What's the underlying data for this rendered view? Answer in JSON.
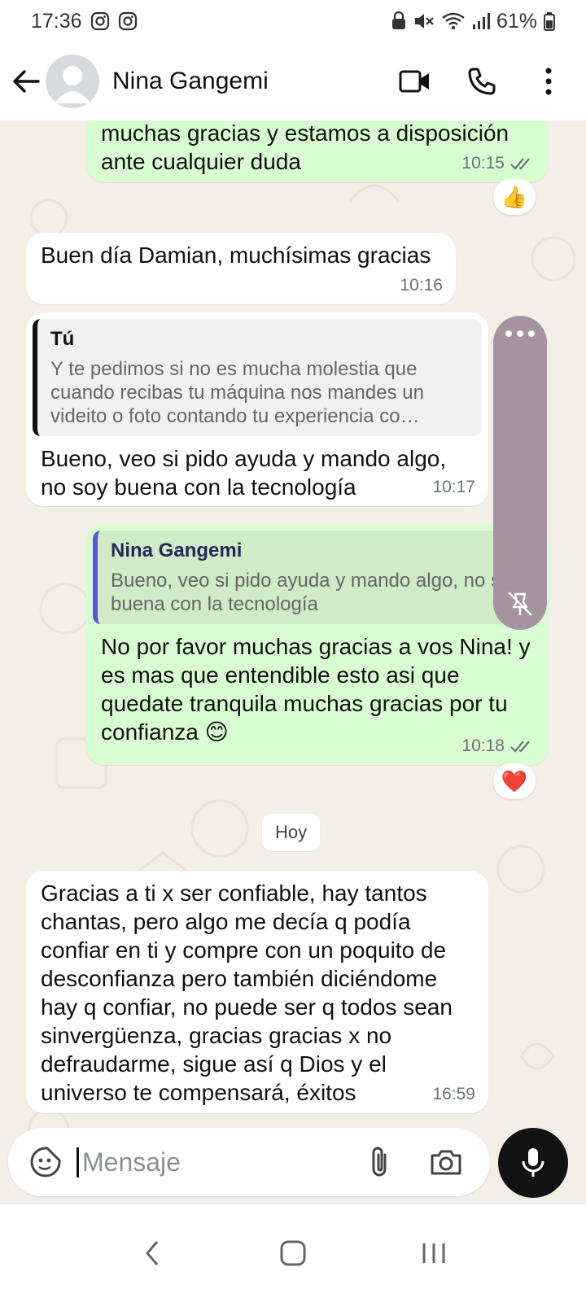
{
  "status_bar": {
    "time": "17:36",
    "battery": "61%"
  },
  "header": {
    "contact_name": "Nina Gangemi"
  },
  "messages": [
    {
      "direction": "out",
      "text": "muchas gracias y estamos a disposición ante cualquier duda",
      "time": "10:15",
      "reaction": "👍"
    },
    {
      "direction": "in",
      "text": "Buen día Damian, muchísimas gracias",
      "time": "10:16"
    },
    {
      "direction": "in",
      "quote": {
        "author": "Tú",
        "text": "Y te pedimos si no es mucha molestia que cuando recibas tu máquina nos mandes un videito o foto contando tu experiencia co…"
      },
      "text": "Bueno, veo si pido ayuda y mando algo, no soy buena con la tecnología",
      "time": "10:17"
    },
    {
      "direction": "out",
      "quote": {
        "author": "Nina Gangemi",
        "text": "Bueno, veo si pido ayuda y mando algo, no soy buena con la tecnología"
      },
      "text": "No por favor muchas gracias a vos Nina! y es mas que entendible esto asi que quedate tranquila muchas gracias por tu confianza 😊",
      "time": "10:18",
      "reaction": "❤️"
    },
    {
      "direction": "in",
      "text": "Gracias a ti x ser confiable, hay tantos chantas, pero algo me decía q podía confiar en ti y compre con un poquito de desconfianza pero también diciéndome hay q confiar, no puede ser q todos sean sinvergüenza, gracias gracias x no defraudarme, sigue así q Dios y el universo te compensará, éxitos",
      "time": "16:59"
    }
  ],
  "date_divider": "Hoy",
  "composer": {
    "placeholder": "Mensaje"
  },
  "colors": {
    "outgoing_bubble": "#d9fdd3",
    "incoming_bubble": "#ffffff",
    "chat_background": "#f3eee6",
    "side_tool": "#a4949f"
  },
  "icons": [
    "instagram-icon",
    "mute-icon",
    "wifi-icon",
    "signal-icon",
    "battery-icon",
    "back-arrow-icon",
    "video-call-icon",
    "phone-icon",
    "more-options-icon",
    "sticker-icon",
    "attach-icon",
    "camera-icon",
    "mic-icon"
  ]
}
